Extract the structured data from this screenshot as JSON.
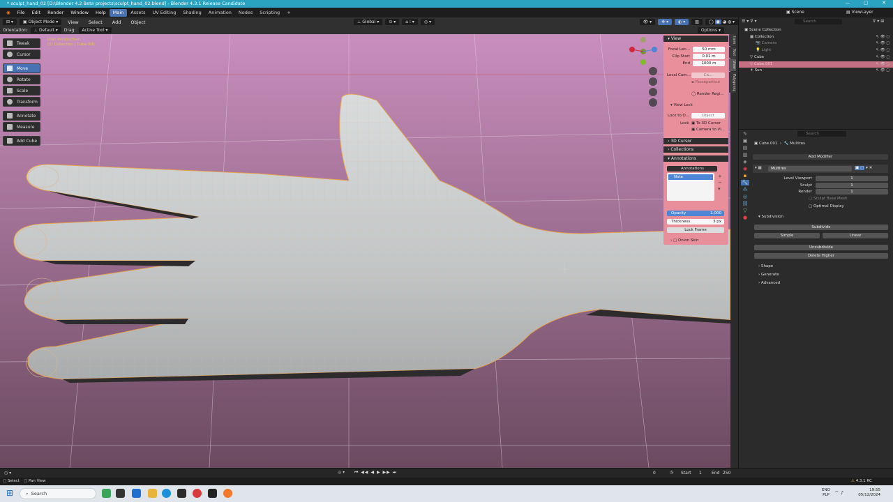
{
  "window": {
    "title": "* sculpt_hand_02 [D:\\Blender 4.2 Beta projects\\sculpt_hand_02.blend] - Blender 4.3.1 Release Candidate",
    "controls": [
      "—",
      "▢",
      "✕"
    ]
  },
  "menu": {
    "items": [
      "File",
      "Edit",
      "Render",
      "Window",
      "Help"
    ],
    "workspaces": [
      "Main",
      "Assets",
      "UV Editing",
      "Shading",
      "Animation",
      "Nodes",
      "Scripting",
      "+"
    ],
    "active_workspace": "Main",
    "scene_label": "Scene",
    "viewlayer_label": "ViewLayer"
  },
  "viewport_header": {
    "mode": "Object Mode",
    "menus": [
      "View",
      "Select",
      "Add",
      "Object"
    ],
    "transform_orientation": "Global",
    "orientation_label": "Orientation:",
    "orientation_value": "Default",
    "drag_label": "Drag:",
    "drag_value": "Active Tool",
    "options_label": "Options"
  },
  "viewport_overlay_text": {
    "line1": "User Perspective",
    "line2": "(1) Collection | Cube.001"
  },
  "toolbar": {
    "tools": [
      {
        "label": "Tweak",
        "icon": "cursor-icon",
        "active": false
      },
      {
        "label": "Cursor",
        "icon": "3d-cursor-icon",
        "active": false
      },
      {
        "label": "Move",
        "icon": "move-icon",
        "active": true
      },
      {
        "label": "Rotate",
        "icon": "rotate-icon",
        "active": false
      },
      {
        "label": "Scale",
        "icon": "scale-icon",
        "active": false
      },
      {
        "label": "Transform",
        "icon": "transform-icon",
        "active": false
      },
      {
        "label": "Annotate",
        "icon": "annotate-icon",
        "active": false
      },
      {
        "label": "Measure",
        "icon": "measure-icon",
        "active": false
      },
      {
        "label": "Add Cube",
        "icon": "add-cube-icon",
        "active": false
      }
    ]
  },
  "npanel": {
    "view_header": "View",
    "focal_label": "Focal Len...",
    "focal_value": "50 mm",
    "clip_start_label": "Clip Start",
    "clip_start_value": "0.01 m",
    "end_label": "End",
    "end_value": "1000 m",
    "local_camera_label": "Local Cam...",
    "local_camera_value": "Ca...",
    "passepartout": "Passepartout",
    "render_region": "Render Regi...",
    "view_lock_header": "View Lock",
    "lock_to_object_label": "Lock to O...",
    "lock_to_object_value": "Object",
    "lock_label": "Lock",
    "to_3d_cursor": "To 3D Cursor",
    "camera_to_view": "Camera to Vi...",
    "cursor_header": "3D Cursor",
    "collections_header": "Collections",
    "annotations_header": "Annotations",
    "annotations_field": "Annotations",
    "layer_name": "Note",
    "opacity_label": "Opacity",
    "opacity_value": "1.000",
    "thickness_label": "Thickness",
    "thickness_value": "3 px",
    "lock_frame": "Lock Frame",
    "onion_skin": "Onion Skin",
    "tabs": [
      "Item",
      "Tool",
      "View",
      "Polygoniq"
    ]
  },
  "outliner": {
    "search_placeholder": "Search",
    "rows": [
      {
        "label": "Scene Collection",
        "indent": 0,
        "highlight": false,
        "muted": false
      },
      {
        "label": "Collection",
        "indent": 1,
        "highlight": false,
        "muted": false
      },
      {
        "label": "Camera",
        "indent": 2,
        "highlight": false,
        "muted": true
      },
      {
        "label": "Light",
        "indent": 2,
        "highlight": false,
        "muted": true
      },
      {
        "label": "Cube",
        "indent": 1,
        "highlight": false,
        "muted": false
      },
      {
        "label": "Cube.001",
        "indent": 1,
        "highlight": true,
        "muted": false
      },
      {
        "label": "Sun",
        "indent": 1,
        "highlight": false,
        "muted": false
      }
    ]
  },
  "properties": {
    "search_placeholder": "Search",
    "breadcrumb_object": "Cube.001",
    "breadcrumb_modifier": "Multires",
    "add_modifier": "Add Modifier",
    "modifier_name": "Multires",
    "level_viewport_label": "Level Viewport",
    "level_viewport_value": "1",
    "sculpt_label": "Sculpt",
    "sculpt_value": "1",
    "render_label": "Render",
    "render_value": "1",
    "sculpt_base_mesh": "Sculpt Base Mesh",
    "optimal_display": "Optimal Display",
    "subdivision_header": "Subdivision",
    "subdivide": "Subdivide",
    "simple": "Simple",
    "linear": "Linear",
    "unsubdivide": "Unsubdivide",
    "delete_higher": "Delete Higher",
    "shape_header": "Shape",
    "generate_header": "Generate",
    "advanced_header": "Advanced"
  },
  "timeline": {
    "current_frame": "0",
    "start_label": "Start",
    "start_value": "1",
    "end_label": "End",
    "end_value": "250"
  },
  "statusbar": {
    "select": "Select",
    "pan_view": "Pan View",
    "version": "4.3.1 RC"
  },
  "taskbar": {
    "search_placeholder": "Search",
    "lang_line1": "ENG",
    "lang_line2": "PLP",
    "time": "19:55",
    "date": "05/12/2024"
  },
  "colors": {
    "titlebar": "#2aa3c0",
    "accent": "#4772b3",
    "npanel_bg": "#e98f9b",
    "viewport_top": "#c98ebd",
    "viewport_bottom": "#6b4a60",
    "selection_outline": "#e8a24a",
    "mesh_color": "#c9cccd"
  }
}
